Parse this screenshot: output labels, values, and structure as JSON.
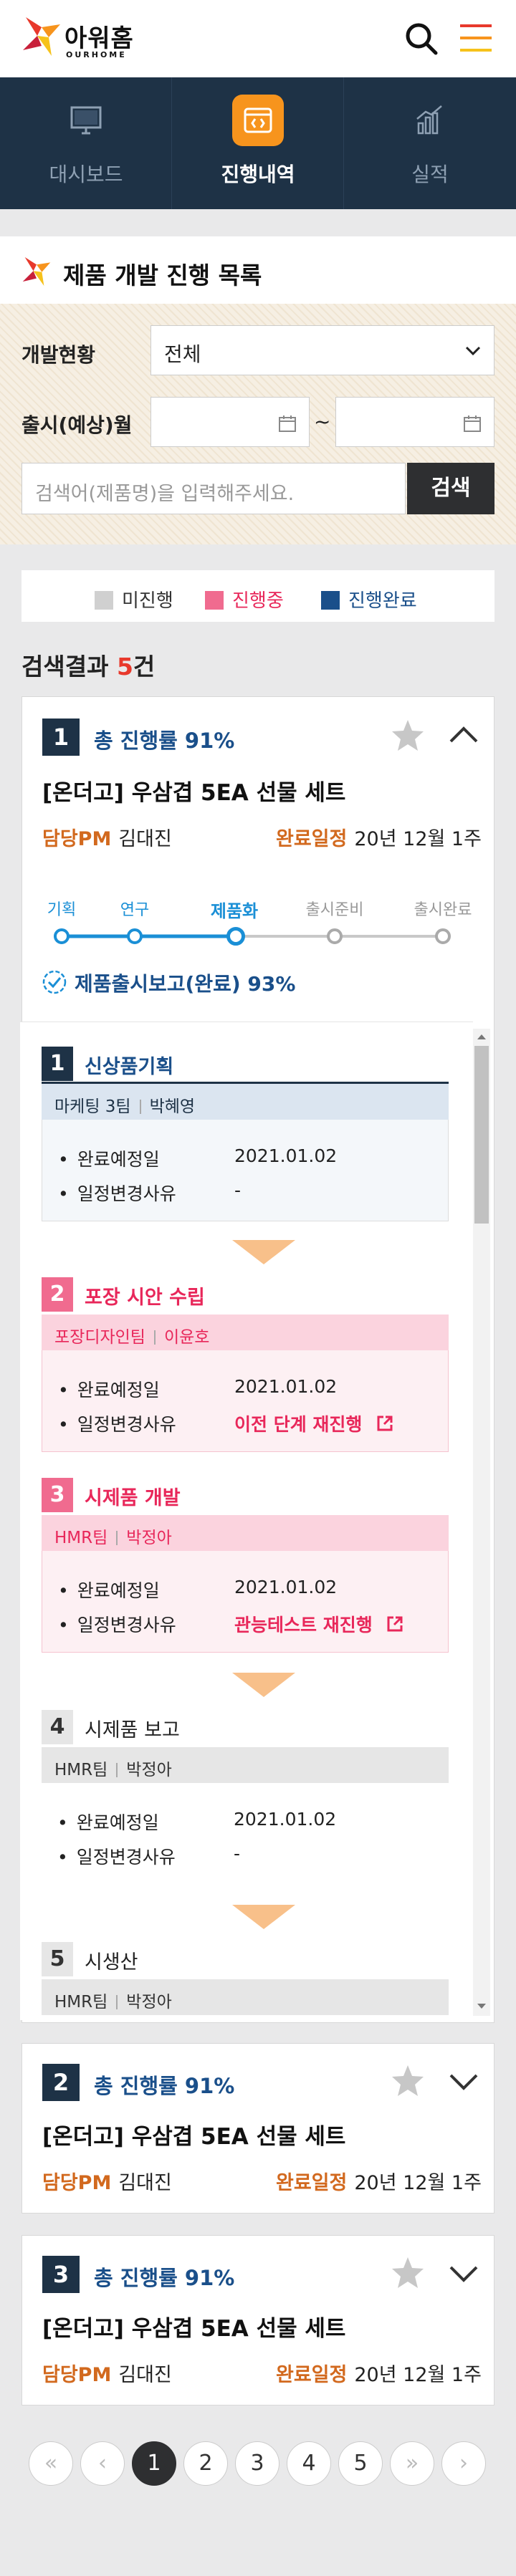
{
  "header": {
    "logo_kor": "아워홈",
    "logo_eng": "OURHOME"
  },
  "nav": {
    "items": [
      {
        "label": "대시보드",
        "icon": "monitor-icon",
        "active": false
      },
      {
        "label": "진행내역",
        "icon": "progress-icon",
        "active": true
      },
      {
        "label": "실적",
        "icon": "bar-chart-icon",
        "active": false
      }
    ]
  },
  "page_title": "제품 개발 진행 목록",
  "filter": {
    "status_label": "개발현황",
    "status_value": "전체",
    "date_label": "출시(예상)월",
    "date_separator": "~",
    "search_placeholder": "검색어(제품명)을 입력해주세요.",
    "search_button": "검색"
  },
  "legend": [
    {
      "label": "미진행",
      "color": "#d0d0d0",
      "text_color": "#333333"
    },
    {
      "label": "진행중",
      "color": "#f06b8f",
      "text_color": "#e8275a"
    },
    {
      "label": "진행완료",
      "color": "#1a4f8a",
      "text_color": "#1a4f8a"
    }
  ],
  "results": {
    "prefix": "검색결과 ",
    "count": "5",
    "suffix": "건"
  },
  "cards": [
    {
      "number": "1",
      "progress": "총 진행률 91%",
      "title": "[온더고] 우삼겹 5EA 선물 세트",
      "pm_label": "담당PM",
      "pm_name": "김대진",
      "due_label": "완료일정",
      "due_value": "20년 12월 1주",
      "expanded": true,
      "steps": [
        {
          "label": "기획",
          "state": "done"
        },
        {
          "label": "연구",
          "state": "done"
        },
        {
          "label": "제품화",
          "state": "current"
        },
        {
          "label": "출시준비",
          "state": "todo"
        },
        {
          "label": "출시완료",
          "state": "todo"
        }
      ],
      "report": "제품출시보고(완료) 93%",
      "stages": [
        {
          "number": "1",
          "title": "신상품기획",
          "team": "마케팅 3팀",
          "person": "박혜영",
          "state": "done",
          "date_label": "완료예정일",
          "date": "2021.01.02",
          "reason_label": "일정변경사유",
          "reason": "-"
        },
        {
          "number": "2",
          "title": "포장 시안 수립",
          "team": "포장디자인팀",
          "person": "이윤호",
          "state": "progress",
          "date_label": "완료예정일",
          "date": "2021.01.02",
          "reason_label": "일정변경사유",
          "reason": "이전 단계 재진행"
        },
        {
          "number": "3",
          "title": "시제품 개발",
          "team": "HMR팀",
          "person": "박정아",
          "state": "progress",
          "date_label": "완료예정일",
          "date": "2021.01.02",
          "reason_label": "일정변경사유",
          "reason": "관능테스트 재진행"
        },
        {
          "number": "4",
          "title": "시제품 보고",
          "team": "HMR팀",
          "person": "박정아",
          "state": "todo",
          "date_label": "완료예정일",
          "date": "2021.01.02",
          "reason_label": "일정변경사유",
          "reason": "-"
        },
        {
          "number": "5",
          "title": "시생산",
          "team": "HMR팀",
          "person": "박정아",
          "state": "todo"
        }
      ]
    },
    {
      "number": "2",
      "progress": "총 진행률 91%",
      "title": "[온더고] 우삼겹 5EA 선물 세트",
      "pm_label": "담당PM",
      "pm_name": "김대진",
      "due_label": "완료일정",
      "due_value": "20년 12월 1주",
      "expanded": false
    },
    {
      "number": "3",
      "progress": "총 진행률 91%",
      "title": "[온더고] 우삼겹 5EA 선물 세트",
      "pm_label": "담당PM",
      "pm_name": "김대진",
      "due_label": "완료일정",
      "due_value": "20년 12월 1주",
      "expanded": false
    }
  ],
  "pagination": {
    "first": "«",
    "prev": "‹",
    "pages": [
      "1",
      "2",
      "3",
      "4",
      "5"
    ],
    "current": "1",
    "next": "›",
    "last": "»"
  },
  "colors": {
    "navy": "#1e3246",
    "accent": "#f7941d",
    "progress_pink": "#e8275a",
    "done_blue": "#1a4f8a",
    "step_blue": "#1a8fd6"
  }
}
